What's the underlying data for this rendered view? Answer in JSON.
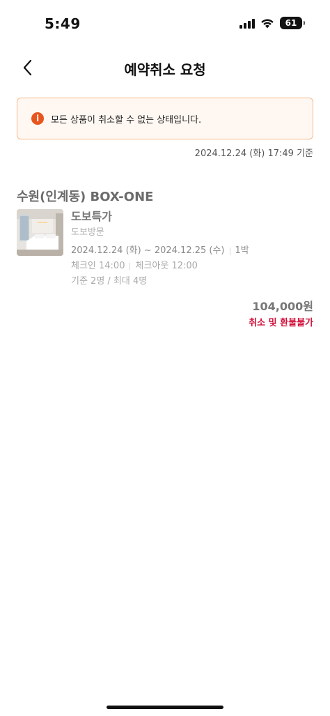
{
  "status_bar": {
    "time": "5:49",
    "battery": "61"
  },
  "header": {
    "title": "예약취소 요청",
    "back_icon": "chevron-left-icon"
  },
  "notice": {
    "icon": "info-icon",
    "icon_glyph": "i",
    "message": "모든 상품이 취소할 수 없는 상태입니다.",
    "accent_color": "#e6561e"
  },
  "timestamp": "2024.12.24 (화) 17:49 기준",
  "reservation": {
    "hotel_name": "수원(인계동) BOX-ONE",
    "room_name": "도보특가",
    "room_type": "도보방문",
    "dates": "2024.12.24 (화) ~ 2024.12.25 (수)",
    "nights": "1박",
    "checkin": "체크인 14:00",
    "checkout": "체크아웃 12:00",
    "capacity": "기준 2명 / 최대 4명",
    "price": "104,000원",
    "refund_policy": "취소 및 환불불가",
    "refund_color": "#d0103a"
  }
}
